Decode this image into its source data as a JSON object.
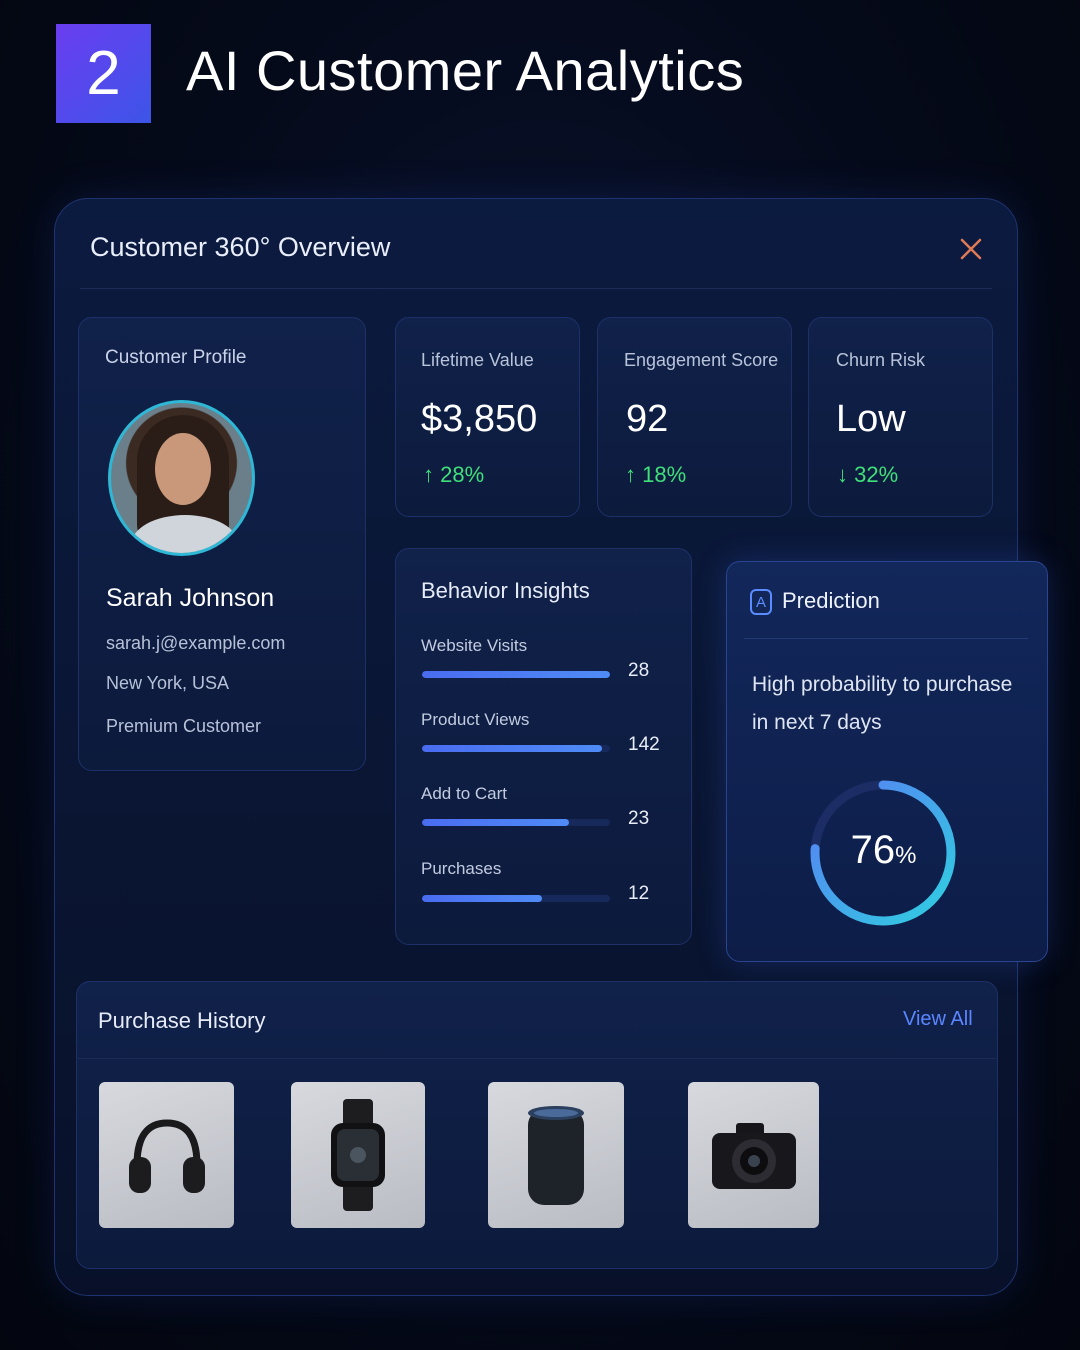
{
  "header": {
    "number": "2",
    "title": "AI Customer Analytics"
  },
  "window": {
    "title": "Customer 360° Overview",
    "close_icon": "close-icon"
  },
  "profile": {
    "label": "Customer Profile",
    "name": "Sarah Johnson",
    "email": "sarah.j@example.com",
    "location": "New York, USA",
    "tier": "Premium Customer"
  },
  "metrics": [
    {
      "label": "Lifetime Value",
      "value": "$3,850",
      "change": "↑ 28%",
      "change_color": "#3fe07a"
    },
    {
      "label": "Engagement Score",
      "value": "92",
      "change": "↑ 18%",
      "change_color": "#3fe07a"
    },
    {
      "label": "Churn Risk",
      "value": "Low",
      "change": "↓ 32%",
      "change_color": "#3fe07a"
    }
  ],
  "behavior": {
    "title": "Behavior Insights",
    "items": [
      {
        "label": "Website Visits",
        "value": "28",
        "fill": 1.0
      },
      {
        "label": "Product Views",
        "value": "142",
        "fill": 0.96
      },
      {
        "label": "Add to Cart",
        "value": "23",
        "fill": 0.78
      },
      {
        "label": "Purchases",
        "value": "12",
        "fill": 0.64
      }
    ]
  },
  "prediction": {
    "icon": "ai-icon",
    "icon_glyph": "A",
    "title": "Prediction",
    "text": "High probability to purchase in next 7 days",
    "value": "76",
    "unit": "%",
    "fraction": 0.76,
    "accent": "#4f8cf7",
    "accent2": "#2fd0e0"
  },
  "purchase_history": {
    "title": "Purchase History",
    "view_all": "View All",
    "items": [
      {
        "icon": "headphones-icon"
      },
      {
        "icon": "smartwatch-icon"
      },
      {
        "icon": "smart-speaker-icon"
      },
      {
        "icon": "camera-icon"
      }
    ]
  }
}
